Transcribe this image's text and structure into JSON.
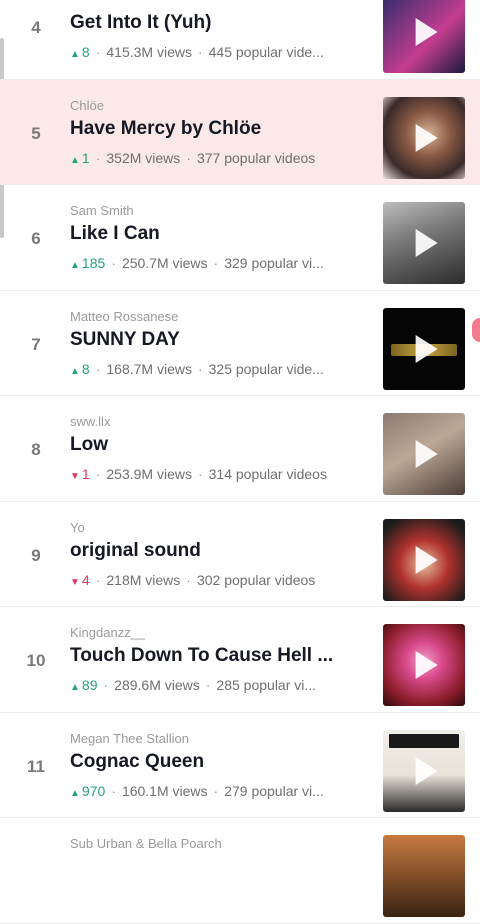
{
  "list": {
    "items": [
      {
        "rank": "4",
        "artist": "",
        "title": "Get Into It (Yuh)",
        "trend": "up",
        "change": "8",
        "views": "415.3M views",
        "videos": "445 popular vide...",
        "thumb_color": "#2b2c6a",
        "thumb_color2": "#c43d8f",
        "highlight": false
      },
      {
        "rank": "5",
        "artist": "Chlöe",
        "title": "Have Mercy by Chlöe",
        "trend": "up",
        "change": "1",
        "views": "352M views",
        "videos": "377 popular videos",
        "thumb_color": "#d8b39a",
        "thumb_color2": "#3a2a2a",
        "highlight": true
      },
      {
        "rank": "6",
        "artist": "Sam Smith",
        "title": "Like I Can",
        "trend": "up",
        "change": "185",
        "views": "250.7M views",
        "videos": "329 popular vi...",
        "thumb_color": "#9a9a9a",
        "thumb_color2": "#2b2b2b",
        "highlight": false
      },
      {
        "rank": "7",
        "artist": "Matteo Rossanese",
        "title": "SUNNY DAY",
        "trend": "up",
        "change": "8",
        "views": "168.7M views",
        "videos": "325 popular vide...",
        "thumb_color": "#050505",
        "thumb_color2": "#c7a640",
        "highlight": false
      },
      {
        "rank": "8",
        "artist": "sww.llx",
        "title": "Low",
        "trend": "down",
        "change": "1",
        "views": "253.9M views",
        "videos": "314 popular videos",
        "thumb_color": "#6a5a52",
        "thumb_color2": "#bca896",
        "highlight": false
      },
      {
        "rank": "9",
        "artist": "Yo",
        "title": "original sound",
        "trend": "down",
        "change": "4",
        "views": "218M views",
        "videos": "302 popular videos",
        "thumb_color": "#b1322e",
        "thumb_color2": "#1c1c1c",
        "highlight": false
      },
      {
        "rank": "10",
        "artist": "Kingdanzz__",
        "title": "Touch Down To Cause Hell ...",
        "trend": "up",
        "change": "89",
        "views": "289.6M views",
        "videos": "285 popular vi...",
        "thumb_color": "#8b1d2a",
        "thumb_color2": "#d94a8c",
        "highlight": false
      },
      {
        "rank": "11",
        "artist": "Megan Thee Stallion",
        "title": "Cognac Queen",
        "trend": "up",
        "change": "970",
        "views": "160.1M views",
        "videos": "279 popular vi...",
        "thumb_color": "#f2efea",
        "thumb_color2": "#2a2a2a",
        "highlight": false
      },
      {
        "rank": "",
        "artist": "Sub Urban & Bella Poarch",
        "title": "",
        "trend": "",
        "change": "",
        "views": "",
        "videos": "",
        "thumb_color": "#c77a3f",
        "thumb_color2": "#3a2212",
        "highlight": false
      }
    ]
  },
  "colors": {
    "highlight_bg": "#fbe9ea",
    "trend_up": "#25a27a",
    "trend_down": "#e0375a"
  },
  "icons": {
    "play": "play-icon",
    "up": "triangle-up-icon",
    "down": "triangle-down-icon"
  }
}
